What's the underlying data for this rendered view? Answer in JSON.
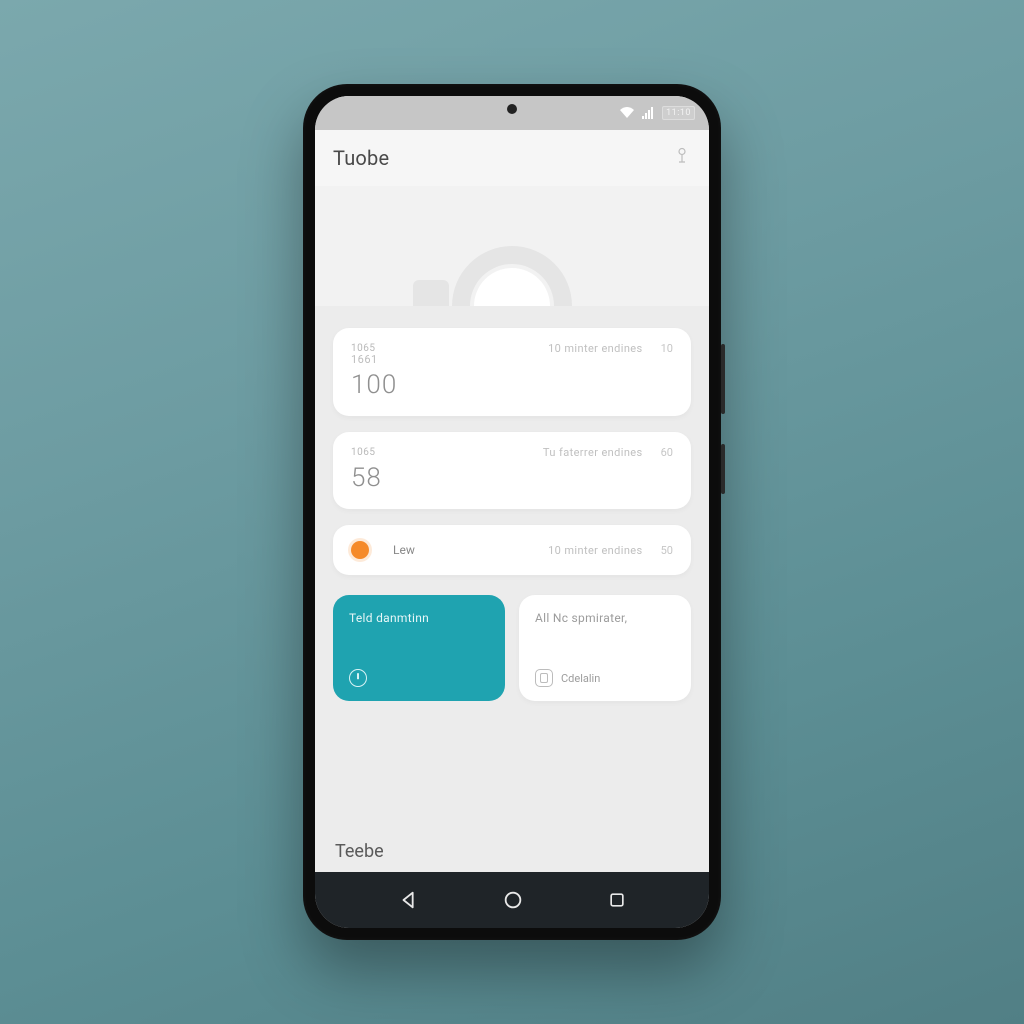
{
  "statusbar": {
    "time": "11:10"
  },
  "header": {
    "title": "Tuobe"
  },
  "cards": [
    {
      "label": "1065",
      "line2": "1661",
      "big": "100",
      "sub": "10 minter endines",
      "val": "10"
    },
    {
      "label": "1065",
      "big": "58",
      "sub": "Tu faterrer endines",
      "val": "60"
    }
  ],
  "slim": {
    "label": "Lew",
    "sub": "10 minter endines",
    "val": "50"
  },
  "tiles": {
    "accent": {
      "title": "Teld danmtinn",
      "sub": ""
    },
    "plain": {
      "title": "All Nc spmirater,",
      "sub": "Cdelalin"
    }
  },
  "footer": {
    "label": "Teebe"
  },
  "colors": {
    "accent": "#1fa3b0",
    "dot": "#f58a2a"
  }
}
